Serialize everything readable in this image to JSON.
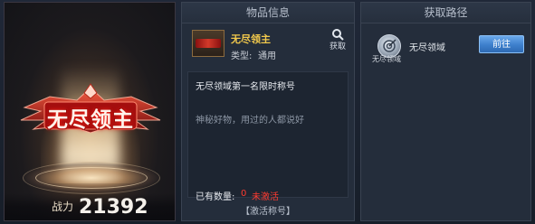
{
  "showcase": {
    "emblem_text": "无尽领主",
    "power_label": "战力",
    "power_value": "21392"
  },
  "item_panel": {
    "header": "物品信息",
    "item_name": "无尽领主",
    "type_label": "类型:",
    "type_value": "通用",
    "acquire_label": "获取",
    "description_title": "无尽领域第一名限时称号",
    "flavor_text": "神秘好物，用过的人都说好",
    "quantity_label": "已有数量:",
    "quantity_value": "0",
    "quantity_status": "未激活",
    "activate_title": "【激活称号】"
  },
  "source_panel": {
    "header": "获取路径",
    "sources": [
      {
        "icon": "target-icon",
        "icon_label": "无尽领域",
        "name": "无尽领域",
        "button_label": "前往"
      }
    ]
  },
  "colors": {
    "item_name": "#f2c94c",
    "not_activated": "#ff3b30",
    "goto_button": "#3d7fcc"
  }
}
